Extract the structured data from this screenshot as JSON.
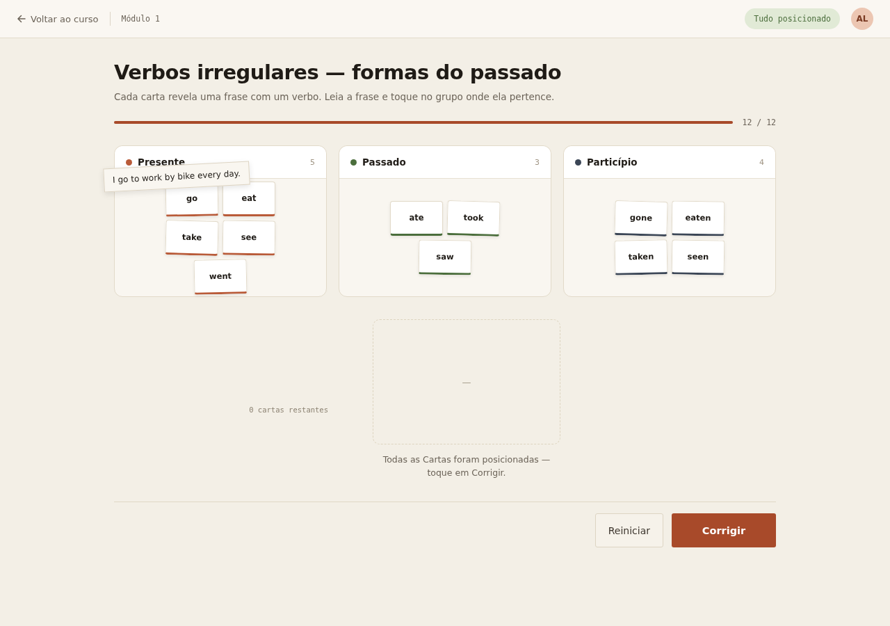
{
  "topbar": {
    "back_link": "Voltar ao curso",
    "module": "Módulo 1",
    "status_badge": "Tudo posicionado",
    "avatar": "AL"
  },
  "title": "Verbos irregulares — formas do passado",
  "subtitle": "Cada carta revela uma frase com um verbo. Leia a frase e toque no grupo onde ela pertence.",
  "progress": {
    "level": 1,
    "reading": "12 / 12"
  },
  "groups": [
    {
      "name": "Presente",
      "count": "5",
      "color": "#b95b39",
      "tooltip": "I go to work by bike every day.",
      "cards": [
        "go",
        "eat",
        "take",
        "see",
        "went"
      ]
    },
    {
      "name": "Passado",
      "count": "3",
      "color": "#4b6e3c",
      "cards": [
        "ate",
        "took",
        "saw"
      ]
    },
    {
      "name": "Particípio",
      "count": "4",
      "color": "#3b4656",
      "cards": [
        "gone",
        "eaten",
        "taken",
        "seen"
      ]
    }
  ],
  "deck": {
    "remaining": "0 cartas restantes",
    "slot": "—",
    "caption": "Todas as Cartas foram posicionadas — toque em Corrigir."
  },
  "buttons": [
    {
      "label": "Reiniciar",
      "kind": "secondary"
    },
    {
      "label": "Corrigir",
      "kind": "primary"
    }
  ]
}
